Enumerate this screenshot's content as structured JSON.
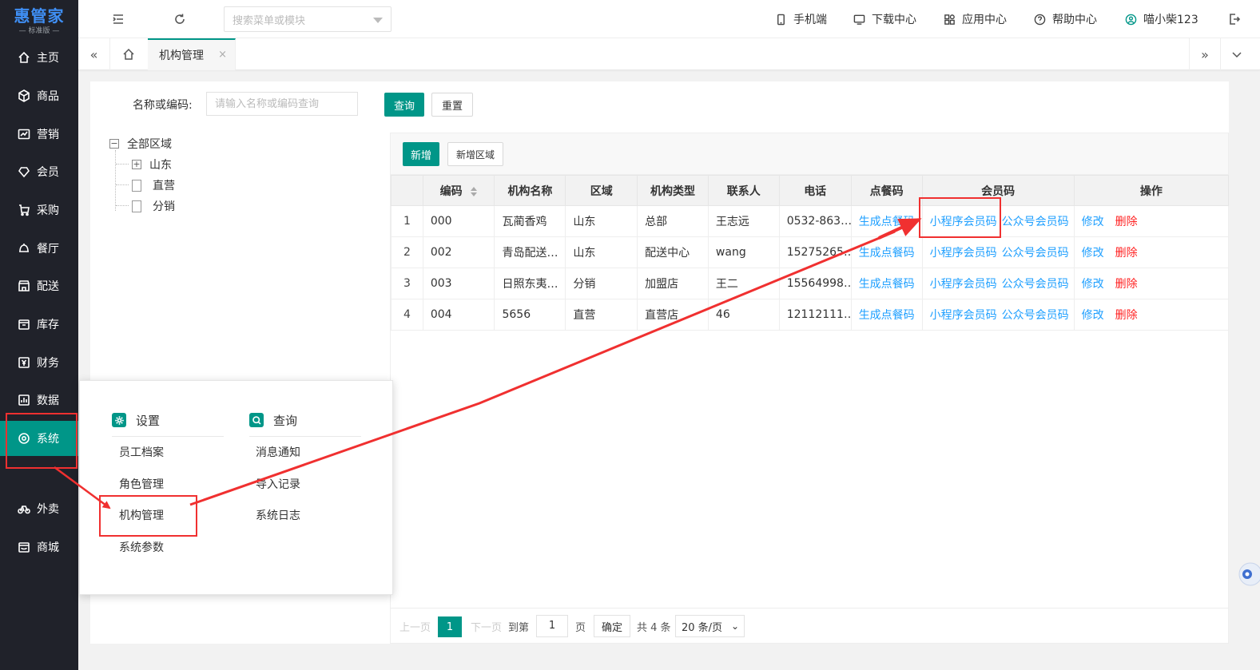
{
  "app": {
    "brand": "惠管家",
    "edition": "— 标准版 —"
  },
  "sidebar": {
    "items": [
      {
        "label": "主页",
        "icon": "home-icon"
      },
      {
        "label": "商品",
        "icon": "cube-icon"
      },
      {
        "label": "营销",
        "icon": "chart-icon"
      },
      {
        "label": "会员",
        "icon": "diamond-icon"
      },
      {
        "label": "采购",
        "icon": "cart-icon"
      },
      {
        "label": "餐厅",
        "icon": "bell-icon"
      },
      {
        "label": "配送",
        "icon": "store-icon"
      },
      {
        "label": "库存",
        "icon": "box-icon"
      },
      {
        "label": "财务",
        "icon": "yen-icon"
      },
      {
        "label": "数据",
        "icon": "bar-chart-icon"
      },
      {
        "label": "系统",
        "icon": "settings-circle-icon",
        "active": true
      },
      {
        "label": "外卖",
        "icon": "bike-icon"
      },
      {
        "label": "商城",
        "icon": "shop-icon"
      }
    ]
  },
  "header": {
    "search_placeholder": "搜索菜单或模块",
    "links": {
      "mobile": "手机端",
      "download": "下载中心",
      "apps": "应用中心",
      "help": "帮助中心",
      "user": "喵小柴123"
    }
  },
  "tabs": {
    "active_label": "机构管理",
    "close": "×"
  },
  "filter": {
    "label": "名称或编码:",
    "placeholder": "请输入名称或编码查询",
    "query_button": "查询",
    "reset_button": "重置"
  },
  "tree": {
    "root": "全部区域",
    "children": [
      "山东",
      "直营",
      "分销"
    ]
  },
  "toolbar": {
    "add_button": "新增",
    "add_region_button": "新增区域"
  },
  "table": {
    "headers": [
      "",
      "编码",
      "机构名称",
      "区域",
      "机构类型",
      "联系人",
      "电话",
      "点餐码",
      "会员码",
      "操作"
    ],
    "rows": [
      {
        "idx": "1",
        "code": "000",
        "name": "瓦蔺香鸡",
        "region": "山东",
        "type": "总部",
        "contact": "王志远",
        "phone": "0532-863…"
      },
      {
        "idx": "2",
        "code": "002",
        "name": "青岛配送…",
        "region": "山东",
        "type": "配送中心",
        "contact": "wang",
        "phone": "15275265…"
      },
      {
        "idx": "3",
        "code": "003",
        "name": "日照东夷…",
        "region": "分销",
        "type": "加盟店",
        "contact": "王二",
        "phone": "15564998…"
      },
      {
        "idx": "4",
        "code": "004",
        "name": "5656",
        "region": "直营",
        "type": "直营店",
        "contact": "46",
        "phone": "12112111…"
      }
    ],
    "link_order_code": "生成点餐码",
    "link_mini_program": "小程序会员码",
    "link_official_account": "公众号会员码",
    "link_edit": "修改",
    "link_delete": "删除"
  },
  "pager": {
    "prev": "上一页",
    "current": "1",
    "next": "下一页",
    "goto": "到第",
    "page_input": "1",
    "page_unit": "页",
    "confirm": "确定",
    "total": "共 4 条",
    "page_size": "20 条/页"
  },
  "popup": {
    "settings_title": "设置",
    "query_title": "查询",
    "settings_items": [
      "员工档案",
      "角色管理",
      "机构管理",
      "系统参数"
    ],
    "query_items": [
      "消息通知",
      "导入记录",
      "系统日志"
    ]
  },
  "colors": {
    "accent": "#009688",
    "sidebar_bg": "#20222a",
    "link": "#1e9fff",
    "danger": "#ff2222",
    "annotation": "#f03030"
  }
}
